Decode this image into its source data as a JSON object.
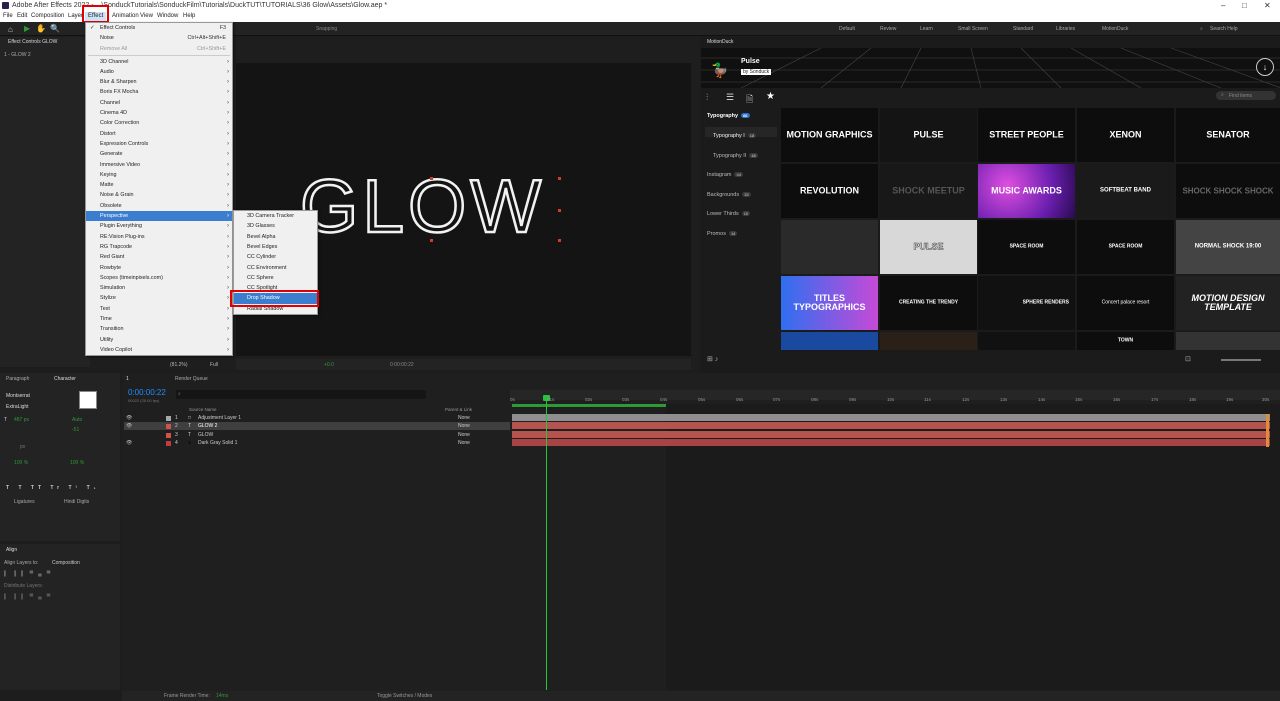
{
  "window": {
    "title": "Adobe After Effects 2022 - ...\\SonduckTutorials\\SonduckFilm\\Tutorials\\DuckTUT\\TUTORIALS\\36 Glow\\Assets\\Glow.aep *",
    "minimize": "–",
    "maximize": "□",
    "close": "✕"
  },
  "menubar": [
    "File",
    "Edit",
    "Composition",
    "Layer",
    "Effect",
    "Animation",
    "View",
    "Window",
    "Help"
  ],
  "toolbar": {
    "snapping": "Snapping",
    "workspaces": [
      "Default",
      "Review",
      "Learn",
      "Small Screen",
      "Standard",
      "Libraries",
      "MotionDuck"
    ],
    "search_placeholder": "Search Help"
  },
  "effect_menu": {
    "items": [
      {
        "label": "Effect Controls",
        "shortcut": "F3",
        "disabled": false,
        "submenu": false,
        "checked": true
      },
      {
        "label": "Noise",
        "shortcut": "Ctrl+Alt+Shift+E",
        "disabled": false,
        "submenu": false
      },
      {
        "label": "Remove All",
        "shortcut": "Ctrl+Shift+E",
        "disabled": true,
        "submenu": false
      },
      {
        "label": "3D Channel",
        "submenu": true
      },
      {
        "label": "Audio",
        "submenu": true
      },
      {
        "label": "Blur & Sharpen",
        "submenu": true
      },
      {
        "label": "Boris FX Mocha",
        "submenu": true
      },
      {
        "label": "Channel",
        "submenu": true
      },
      {
        "label": "Cinema 4D",
        "submenu": true
      },
      {
        "label": "Color Correction",
        "submenu": true
      },
      {
        "label": "Distort",
        "submenu": true
      },
      {
        "label": "Expression Controls",
        "submenu": true
      },
      {
        "label": "Generate",
        "submenu": true
      },
      {
        "label": "Immersive Video",
        "submenu": true
      },
      {
        "label": "Keying",
        "submenu": true
      },
      {
        "label": "Matte",
        "submenu": true
      },
      {
        "label": "Noise & Grain",
        "submenu": true
      },
      {
        "label": "Obsolete",
        "submenu": true
      },
      {
        "label": "Perspective",
        "submenu": true,
        "highlighted": true
      },
      {
        "label": "Plugin Everything",
        "submenu": true
      },
      {
        "label": "RE:Vision Plug-ins",
        "submenu": true
      },
      {
        "label": "RG Trapcode",
        "submenu": true
      },
      {
        "label": "Red Giant",
        "submenu": true
      },
      {
        "label": "Rowbyte",
        "submenu": true
      },
      {
        "label": "Scopes (timeinpixels.com)",
        "submenu": true
      },
      {
        "label": "Simulation",
        "submenu": true
      },
      {
        "label": "Stylize",
        "submenu": true
      },
      {
        "label": "Text",
        "submenu": true
      },
      {
        "label": "Time",
        "submenu": true
      },
      {
        "label": "Transition",
        "submenu": true
      },
      {
        "label": "Utility",
        "submenu": true
      },
      {
        "label": "Video Copilot",
        "submenu": true
      }
    ]
  },
  "perspective_menu": {
    "items": [
      "3D Camera Tracker",
      "3D Glasses",
      "Bevel Alpha",
      "Bevel Edges",
      "CC Cylinder",
      "CC Environment",
      "CC Sphere",
      "CC Spotlight",
      "Drop Shadow",
      "Radial Shadow"
    ],
    "highlighted": "Drop Shadow"
  },
  "effect_controls": {
    "tab": "Effect Controls GLOW",
    "layer": "1 - GLOW 2"
  },
  "composition": {
    "text": "GLOW",
    "zoom": "(81.2%)",
    "quality": "Full",
    "timecode": "0:00:00:22",
    "exposure": "+0.0"
  },
  "motionduck": {
    "panel_title": "MotionDuck",
    "pack_name": "Pulse",
    "by": "by Sonduck",
    "search_placeholder": "Find items",
    "sidebar": [
      {
        "label": "Typography",
        "count": "66"
      },
      {
        "label": "Typography I",
        "count": "18"
      },
      {
        "label": "Typography II",
        "count": "48"
      },
      {
        "label": "Instagram",
        "count": "44"
      },
      {
        "label": "Backgrounds",
        "count": "15"
      },
      {
        "label": "Lower Thirds",
        "count": "10"
      },
      {
        "label": "Promos",
        "count": "14"
      }
    ],
    "thumbs": [
      "MOTION GRAPHICS",
      "PULSE",
      "STREET PEOPLE",
      "XENON",
      "SENATOR",
      "REVOLUTION",
      "SHOCK MEETUP",
      "MUSIC AWARDS",
      "SOFTBEAT BAND",
      "SHOCK SHOCK SHOCK",
      "",
      "PULSE",
      "SPACE ROOM",
      "SPACE ROOM",
      "NORMAL SHOCK 19:00",
      "TITLES TYPOGRAPHICS",
      "CREATING THE TRENDY",
      "SPHERE RENDERS",
      "Concert palace resort",
      "MOTION DESIGN TEMPLATE",
      "",
      "",
      "",
      "TOWN",
      ""
    ]
  },
  "character": {
    "tabs": [
      "Paragraph",
      "Character"
    ],
    "font": "Montserrat",
    "style": "ExtraLight",
    "size": "487 px",
    "leading": "Auto",
    "tracking": "-51",
    "unit": "px",
    "v_scale": "100 %",
    "h_scale": "100 %",
    "ligatures": "Ligatures",
    "hindi_digits": "Hindi Digits"
  },
  "align": {
    "title": "Align",
    "align_to_label": "Align Layers to:",
    "align_to_value": "Composition",
    "distribute": "Distribute Layers:"
  },
  "timeline": {
    "tabs": [
      "1",
      "Render Queue"
    ],
    "timecode": "0:00:00:22",
    "frame_info": "00022 (25.00 fps)",
    "search_placeholder": "",
    "col_source": "Source Name",
    "col_parent": "Parent & Link",
    "layers": [
      {
        "num": "1",
        "name": "Adjustment Layer 1",
        "parent": "None",
        "color": "#a8a8a8",
        "icon": "□"
      },
      {
        "num": "2",
        "name": "GLOW 2",
        "parent": "None",
        "color": "#d0524c",
        "icon": "T"
      },
      {
        "num": "3",
        "name": "GLOW",
        "parent": "None",
        "color": "#d0524c",
        "icon": "T"
      },
      {
        "num": "4",
        "name": "Dark Gray Solid 1",
        "parent": "None",
        "color": "#c43b3b",
        "icon": "■"
      }
    ],
    "ruler": [
      "0s",
      "01s",
      "02s",
      "03s",
      "04s",
      "05s",
      "06s",
      "07s",
      "08s",
      "09s",
      "10s",
      "11s",
      "12s",
      "13s",
      "14s",
      "15s",
      "16s",
      "17s",
      "18s",
      "19s",
      "20s"
    ],
    "footer_render": "Frame Render Time:",
    "footer_render_value": "14ms",
    "footer_toggle": "Toggle Switches / Modes"
  }
}
